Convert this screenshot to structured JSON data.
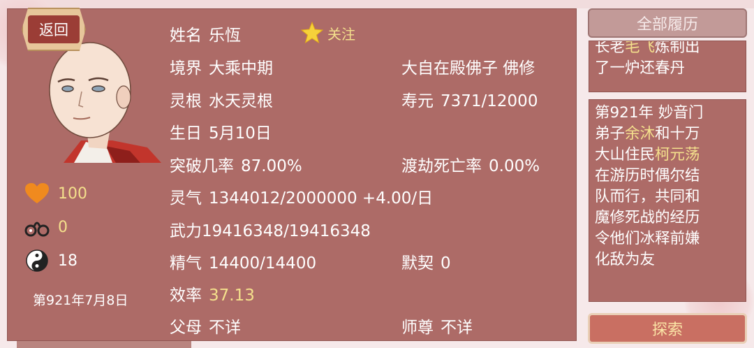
{
  "back_label": "返回",
  "follow_label": "关注",
  "stats": {
    "heart": "100",
    "chain": "0",
    "yinyang": "18"
  },
  "date": "第921年7月8日",
  "info": {
    "name_label": "姓名",
    "name": "乐恆",
    "realm_label": "境界",
    "realm": "大乘中期",
    "sect": "大自在殿佛子  佛修",
    "root_label": "灵根",
    "root": "水天灵根",
    "life_label": "寿元",
    "life": "7371/12000",
    "birthday_label": "生日",
    "birthday": "5月10日",
    "breakthrough_label": "突破几率",
    "breakthrough": "87.00%",
    "tribulation_label": "渡劫死亡率",
    "tribulation": "0.00%",
    "qi_label": "灵气",
    "qi": "1344012/2000000 +4.00/日",
    "force": "武力19416348/19416348",
    "essence_label": "精气",
    "essence": "14400/14400",
    "bond_label": "默契",
    "bond": "0",
    "efficiency_label": "效率",
    "efficiency": "37.13",
    "parents_label": "父母",
    "parents": "不详",
    "master_label": "师尊",
    "master": "不详"
  },
  "side": {
    "all_history_label": "全部履历",
    "log1": {
      "line1_a": "长老",
      "line1_hl": "毛飞",
      "line1_b": "炼制出",
      "line2": "了一炉还春丹"
    },
    "log2": {
      "l1": "第921年 妙音门",
      "l2_a": "弟子",
      "l2_hl": "余沐",
      "l2_b": "和十万",
      "l3_a": "大山住民",
      "l3_hl": "柯元荡",
      "l4": "在游历时偶尔结",
      "l5": "队而行，共同和",
      "l6": "魔修死战的经历",
      "l7": "令他们冰释前嫌",
      "l8": "化敌为友"
    },
    "search_label": "探索"
  },
  "colors": {
    "panel": "#ad6b67",
    "highlight": "#f4e08c",
    "search_btn": "#c96f62"
  }
}
